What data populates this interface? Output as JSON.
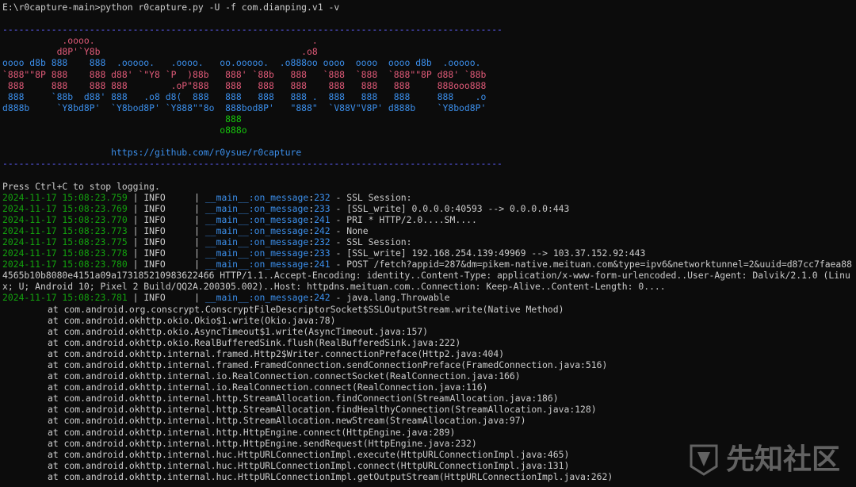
{
  "prompt": "E:\\r0capture-main>python r0capture.py -U -f com.dianping.v1 -v",
  "divider": "--------------------------------------------------------------------------------------------",
  "banner": {
    "lines": [
      {
        "color": "red",
        "text": "           .oooo.                                        ."
      },
      {
        "color": "red",
        "text": "          d8P'`Y8b                                     .o8"
      },
      {
        "color": "blue",
        "text": "oooo d8b 888    888  .ooooo.   .oooo.   oo.ooooo.  .o888oo oooo  oooo  oooo d8b  .ooooo."
      },
      {
        "color": "red",
        "text": "`888\"\"8P 888    888 d88' `\"Y8 `P  )88b   888' `88b   888   `888  `888  `888\"\"8P d88' `88b"
      },
      {
        "color": "red",
        "text": " 888     888    888 888        .oP\"888   888   888   888    888   888   888     888ooo888"
      },
      {
        "color": "blue",
        "text": " 888     `88b  d88' 888   .o8 d8(  888   888   888   888 .  888   888   888     888    .o"
      },
      {
        "color": "blue",
        "text": "d888b     `Y8bd8P'  `Y8bod8P' `Y888\"\"8o  888bod8P'   \"888\"  `V88V\"V8P' d888b    `Y8bod8P'"
      },
      {
        "color": "green",
        "text": "                                         888"
      },
      {
        "color": "green",
        "text": "                                        o888o"
      }
    ],
    "url": "https://github.com/r0ysue/r0capture"
  },
  "stop_msg": "Press Ctrl+C to stop logging.",
  "logs": [
    {
      "ts": "2024-11-17 15:08:23.759",
      "level": "INFO",
      "module": "__main__:on_message",
      "line": "232",
      "msg": "SSL Session:"
    },
    {
      "ts": "2024-11-17 15:08:23.769",
      "level": "INFO",
      "module": "__main__:on_message",
      "line": "233",
      "msg": "[SSL_write] 0.0.0.0:40593 --> 0.0.0.0:443"
    },
    {
      "ts": "2024-11-17 15:08:23.770",
      "level": "INFO",
      "module": "__main__:on_message",
      "line": "241",
      "msg": "PRI * HTTP/2.0....SM...."
    },
    {
      "ts": "2024-11-17 15:08:23.773",
      "level": "INFO",
      "module": "__main__:on_message",
      "line": "242",
      "msg": "None"
    },
    {
      "ts": "2024-11-17 15:08:23.775",
      "level": "INFO",
      "module": "__main__:on_message",
      "line": "232",
      "msg": "SSL Session:"
    },
    {
      "ts": "2024-11-17 15:08:23.778",
      "level": "INFO",
      "module": "__main__:on_message",
      "line": "233",
      "msg": "[SSL_write] 192.168.254.139:49969 --> 103.37.152.92:443"
    },
    {
      "ts": "2024-11-17 15:08:23.780",
      "level": "INFO",
      "module": "__main__:on_message",
      "line": "241",
      "msg": "POST /fetch?appid=287&dm=pikem-native.meituan.com&type=ipv6&networktunnel=2&uuid=d87cc7faea884565b10b8080e4151a09a173185210983622466 HTTP/1.1..Accept-Encoding: identity..Content-Type: application/x-www-form-urlencoded..User-Agent: Dalvik/2.1.0 (Linux; U; Android 10; Pixel 2 Build/QQ2A.200305.002)..Host: httpdns.meituan.com..Connection: Keep-Alive..Content-Length: 0...."
    },
    {
      "ts": "2024-11-17 15:08:23.781",
      "level": "INFO",
      "module": "__main__:on_message",
      "line": "242",
      "msg": "java.lang.Throwable"
    }
  ],
  "stacktrace": [
    "at com.android.org.conscrypt.ConscryptFileDescriptorSocket$SSLOutputStream.write(Native Method)",
    "at com.android.okhttp.okio.Okio$1.write(Okio.java:78)",
    "at com.android.okhttp.okio.AsyncTimeout$1.write(AsyncTimeout.java:157)",
    "at com.android.okhttp.okio.RealBufferedSink.flush(RealBufferedSink.java:222)",
    "at com.android.okhttp.internal.framed.Http2$Writer.connectionPreface(Http2.java:404)",
    "at com.android.okhttp.internal.framed.FramedConnection.sendConnectionPreface(FramedConnection.java:516)",
    "at com.android.okhttp.internal.io.RealConnection.connectSocket(RealConnection.java:166)",
    "at com.android.okhttp.internal.io.RealConnection.connect(RealConnection.java:116)",
    "at com.android.okhttp.internal.http.StreamAllocation.findConnection(StreamAllocation.java:186)",
    "at com.android.okhttp.internal.http.StreamAllocation.findHealthyConnection(StreamAllocation.java:128)",
    "at com.android.okhttp.internal.http.StreamAllocation.newStream(StreamAllocation.java:97)",
    "at com.android.okhttp.internal.http.HttpEngine.connect(HttpEngine.java:289)",
    "at com.android.okhttp.internal.http.HttpEngine.sendRequest(HttpEngine.java:232)",
    "at com.android.okhttp.internal.huc.HttpURLConnectionImpl.execute(HttpURLConnectionImpl.java:465)",
    "at com.android.okhttp.internal.huc.HttpURLConnectionImpl.connect(HttpURLConnectionImpl.java:131)",
    "at com.android.okhttp.internal.huc.HttpURLConnectionImpl.getOutputStream(HttpURLConnectionImpl.java:262)"
  ],
  "watermark": "先知社区",
  "colors": {
    "red": "#e05a78",
    "blue": "#3b8eea",
    "green": "#16c60c",
    "timestamp": "#13a10e",
    "divider": "#5f5fff"
  }
}
